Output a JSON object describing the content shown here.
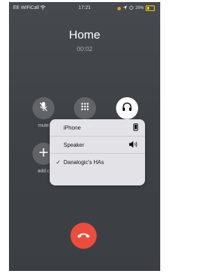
{
  "status_bar": {
    "carrier": "EE WiFiCall",
    "time": "17:21",
    "battery": "25%"
  },
  "call": {
    "contact": "Home",
    "duration": "00:02"
  },
  "controls": [
    {
      "label": "mute",
      "icon": "mic-off-icon"
    },
    {
      "label": "keypad",
      "icon": "keypad-icon"
    },
    {
      "label": "audio",
      "icon": "headphones-icon"
    },
    {
      "label": "add c",
      "icon": "plus-icon"
    }
  ],
  "audio_menu": {
    "items": [
      {
        "label": "iPhone",
        "icon": "phone-icon",
        "selected": false
      },
      {
        "label": "Speaker",
        "icon": "speaker-icon",
        "selected": false
      },
      {
        "label": "Danalogic's HAs",
        "icon": "",
        "selected": true
      }
    ],
    "check_mark": "✓"
  },
  "colors": {
    "end_call": "#eb4d3d",
    "background": "#43474b"
  }
}
